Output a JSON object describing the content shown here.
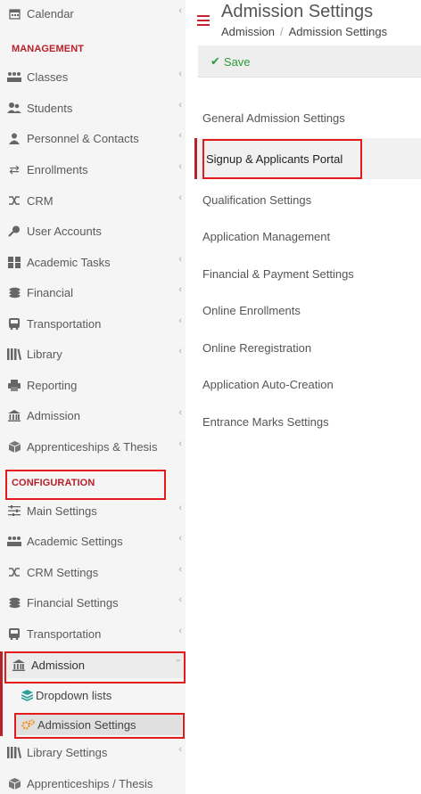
{
  "sidebar": {
    "calendar": "Calendar",
    "management_header": "MANAGEMENT",
    "management_items": [
      {
        "label": "Classes",
        "icon": "classes-icon"
      },
      {
        "label": "Students",
        "icon": "students-icon"
      },
      {
        "label": "Personnel & Contacts",
        "icon": "personnel-icon"
      },
      {
        "label": "Enrollments",
        "icon": "enrollments-icon"
      },
      {
        "label": "CRM",
        "icon": "crm-icon"
      },
      {
        "label": "User Accounts",
        "icon": "key-icon"
      },
      {
        "label": "Academic Tasks",
        "icon": "tasks-icon"
      },
      {
        "label": "Financial",
        "icon": "coins-icon"
      },
      {
        "label": "Transportation",
        "icon": "bus-icon"
      },
      {
        "label": "Library",
        "icon": "library-icon"
      },
      {
        "label": "Reporting",
        "icon": "printer-icon"
      },
      {
        "label": "Admission",
        "icon": "bank-icon"
      },
      {
        "label": "Apprenticeships & Thesis",
        "icon": "cube-icon"
      }
    ],
    "configuration_header": "CONFIGURATION",
    "configuration_items": [
      {
        "label": "Main Settings",
        "icon": "sliders-icon"
      },
      {
        "label": "Academic Settings",
        "icon": "classes-icon"
      },
      {
        "label": "CRM Settings",
        "icon": "crm-icon"
      },
      {
        "label": "Financial Settings",
        "icon": "coins-icon"
      },
      {
        "label": "Transportation",
        "icon": "bus-icon"
      },
      {
        "label": "Admission",
        "icon": "bank-icon"
      }
    ],
    "admission_sub": {
      "dropdown_lists": "Dropdown lists",
      "admission_settings": "Admission Settings"
    },
    "after_items": [
      {
        "label": "Library Settings",
        "icon": "library-icon"
      },
      {
        "label": "Apprenticeships / Thesis",
        "icon": "cube-icon"
      }
    ]
  },
  "header": {
    "title": "Admission Settings",
    "breadcrumb": [
      "Admission",
      "Admission Settings"
    ],
    "breadcrumb_sep": "/"
  },
  "toolbar": {
    "save_label": "Save"
  },
  "settings_menu": [
    "General Admission Settings",
    "Signup & Applicants Portal",
    "Qualification Settings",
    "Application Management",
    "Financial & Payment Settings",
    "Online Enrollments",
    "Online Reregistration",
    "Application Auto-Creation",
    "Entrance Marks Settings"
  ],
  "colors": {
    "accent_red": "#b8202a",
    "highlight_red": "#e31b1b",
    "save_green": "#2e9c3b"
  }
}
